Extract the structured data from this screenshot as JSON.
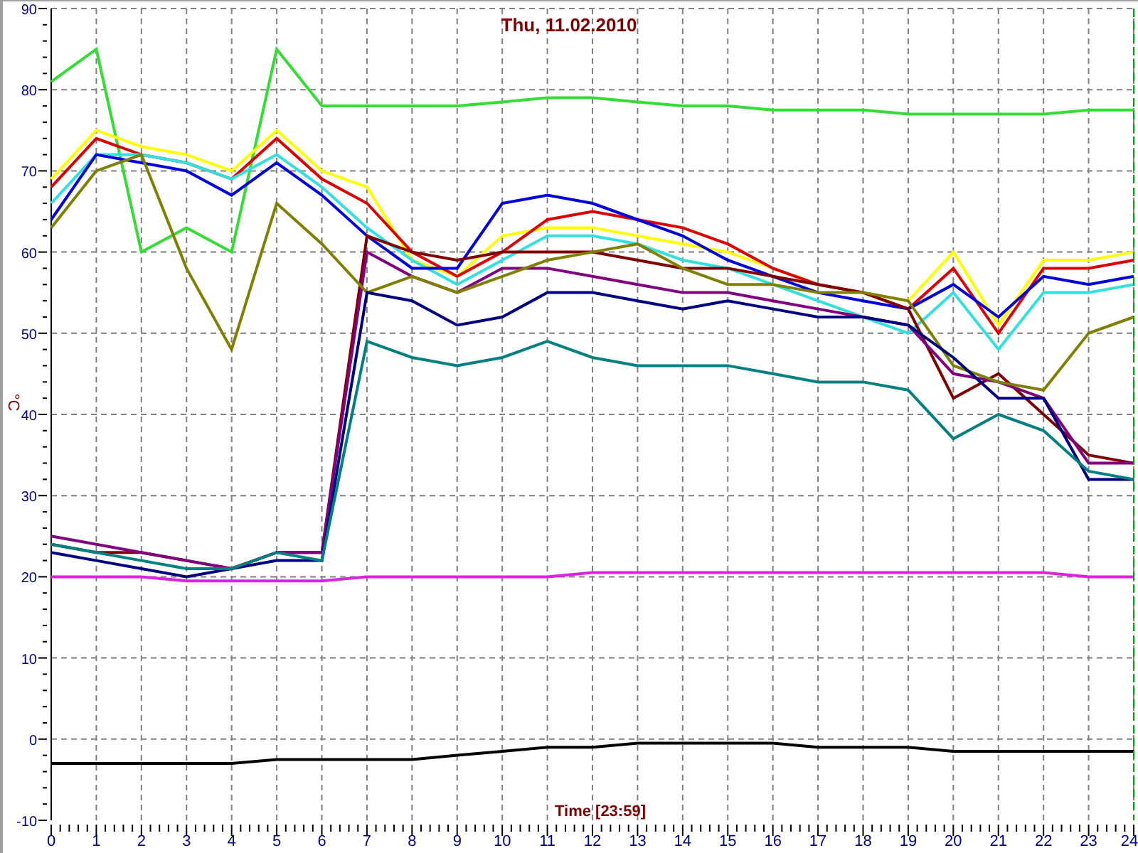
{
  "chart_data": {
    "type": "line",
    "title": "Thu, 11.02.2010",
    "xlabel": "Time [23:59]",
    "ylabel": "°C",
    "x": [
      0,
      1,
      2,
      3,
      4,
      5,
      6,
      7,
      8,
      9,
      10,
      11,
      12,
      13,
      14,
      15,
      16,
      17,
      18,
      19,
      20,
      21,
      22,
      23,
      24
    ],
    "series": [
      {
        "color": "#33dd33",
        "values": [
          81,
          85,
          60,
          63,
          60,
          85,
          78,
          78,
          78,
          78,
          78.5,
          79,
          79,
          78.5,
          78,
          78,
          77.5,
          77.5,
          77.5,
          77,
          77,
          77,
          77,
          77.5,
          77.5
        ]
      },
      {
        "color": "#ffff00",
        "values": [
          69,
          75,
          73,
          72,
          70,
          75,
          70,
          68,
          59,
          57,
          62,
          63,
          63,
          62,
          61,
          60,
          58,
          56,
          55,
          54,
          60,
          51,
          59,
          59,
          60
        ]
      },
      {
        "color": "#dd0000",
        "values": [
          68,
          74,
          72,
          71,
          69,
          74,
          69,
          66,
          60,
          57,
          60,
          64,
          65,
          64,
          63,
          61,
          58,
          56,
          55,
          53,
          58,
          50,
          58,
          58,
          59
        ]
      },
      {
        "color": "#33e0e0",
        "values": [
          66,
          72,
          72,
          71,
          69,
          72,
          68,
          63,
          59,
          56,
          59,
          62,
          62,
          61,
          59,
          58,
          56,
          54,
          52,
          50,
          55,
          48,
          55,
          55,
          56
        ]
      },
      {
        "color": "#0000dd",
        "values": [
          64,
          72,
          71,
          70,
          67,
          71,
          67,
          62,
          58,
          58,
          66,
          67,
          66,
          64,
          62,
          59,
          57,
          55,
          54,
          53,
          56,
          52,
          57,
          56,
          57
        ]
      },
      {
        "color": "#800000",
        "values": [
          24,
          23,
          23,
          22,
          21,
          23,
          23,
          62,
          60,
          59,
          60,
          60,
          60,
          59,
          58,
          58,
          57,
          56,
          55,
          53,
          42,
          45,
          40,
          35,
          34
        ]
      },
      {
        "color": "#800080",
        "values": [
          25,
          24,
          23,
          22,
          21,
          23,
          23,
          60,
          57,
          55,
          58,
          58,
          57,
          56,
          55,
          55,
          54,
          53,
          52,
          51,
          45,
          44,
          42,
          34,
          34
        ]
      },
      {
        "color": "#808000",
        "values": [
          63,
          70,
          72,
          58,
          48,
          66,
          61,
          55,
          57,
          55,
          57,
          59,
          60,
          61,
          58,
          56,
          56,
          55,
          55,
          54,
          46,
          44,
          43,
          50,
          52
        ]
      },
      {
        "color": "#000080",
        "values": [
          23,
          22,
          21,
          20,
          21,
          22,
          22,
          55,
          54,
          51,
          52,
          55,
          55,
          54,
          53,
          54,
          53,
          52,
          52,
          51,
          47,
          42,
          42,
          32,
          32
        ]
      },
      {
        "color": "#008080",
        "values": [
          24,
          23,
          22,
          21,
          21,
          23,
          22,
          49,
          47,
          46,
          47,
          49,
          47,
          46,
          46,
          46,
          45,
          44,
          44,
          43,
          37,
          40,
          38,
          33,
          32
        ]
      },
      {
        "color": "#e020e0",
        "values": [
          20,
          20,
          20,
          19.5,
          19.5,
          19.5,
          19.5,
          20,
          20,
          20,
          20,
          20,
          20.5,
          20.5,
          20.5,
          20.5,
          20.5,
          20.5,
          20.5,
          20.5,
          20.5,
          20.5,
          20.5,
          20,
          20
        ]
      },
      {
        "color": "#000000",
        "values": [
          -3,
          -3,
          -3,
          -3,
          -3,
          -2.5,
          -2.5,
          -2.5,
          -2.5,
          -2,
          -1.5,
          -1,
          -1,
          -0.5,
          -0.5,
          -0.5,
          -0.5,
          -1,
          -1,
          -1,
          -1.5,
          -1.5,
          -1.5,
          -1.5,
          -1.5
        ]
      }
    ],
    "grid": true,
    "xlim": [
      0,
      24
    ],
    "ylim": [
      -10,
      90
    ],
    "xticks": [
      0,
      1,
      2,
      3,
      4,
      5,
      6,
      7,
      8,
      9,
      10,
      11,
      12,
      13,
      14,
      15,
      16,
      17,
      18,
      19,
      20,
      21,
      22,
      23,
      24
    ],
    "yticks": [
      -10,
      0,
      10,
      20,
      30,
      40,
      50,
      60,
      70,
      80,
      90
    ]
  }
}
